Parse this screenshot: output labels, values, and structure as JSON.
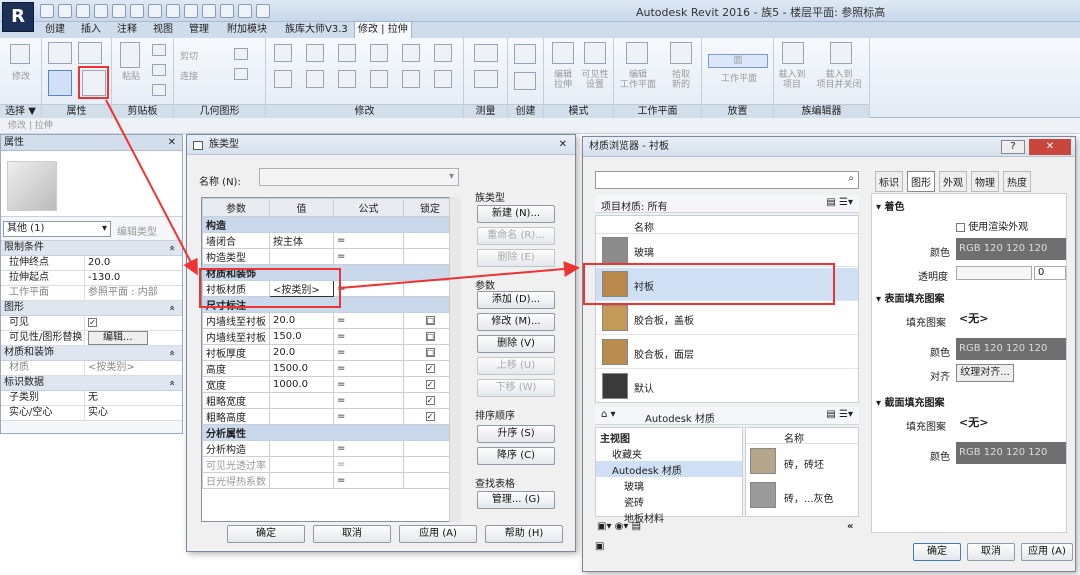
{
  "app": {
    "logo": "R",
    "title": "Autodesk Revit 2016 -     族5 - 楼层平面: 参照标高"
  },
  "tabs": [
    "创建",
    "插入",
    "注释",
    "视图",
    "管理",
    "附加模块",
    "族库大师V3.3",
    "修改 | 拉伸"
  ],
  "ribbon": {
    "panels": [
      "选择",
      "属性",
      "剪贴板",
      "几何图形",
      "修改",
      "测量",
      "创建",
      "模式",
      "工作平面",
      "放置",
      "族编辑器"
    ],
    "buttons": {
      "modify": "修改",
      "select": "选择 ▼",
      "paste": "粘贴",
      "cut": "剪切",
      "join": "连接",
      "edit_extrusion": "编辑\n拉伸",
      "visibility": "可见性\n设置",
      "edit_workplane": "编辑\n工作平面",
      "pick_new": "拾取\n新的",
      "face": "面",
      "workplane": "工作平面",
      "load_project": "载入到\n项目",
      "load_close": "载入到\n项目并关闭"
    }
  },
  "context": "修改 | 拉伸",
  "properties": {
    "title": "属性",
    "close": "✕",
    "type_selector": "其他 (1)",
    "edit_type": "编辑类型",
    "groups": [
      {
        "name": "限制条件",
        "rows": [
          [
            "拉伸终点",
            "20.0"
          ],
          [
            "拉伸起点",
            "-130.0"
          ],
          [
            "工作平面",
            "参照平面 : 内部"
          ]
        ]
      },
      {
        "name": "图形",
        "rows": [
          [
            "可见",
            "✓"
          ],
          [
            "可见性/图形替换",
            "编辑..."
          ]
        ]
      },
      {
        "name": "材质和装饰",
        "rows": [
          [
            "材质",
            "<按类别>"
          ]
        ]
      },
      {
        "name": "标识数据",
        "rows": [
          [
            "子类别",
            "无"
          ],
          [
            "实心/空心",
            "实心"
          ]
        ]
      }
    ]
  },
  "family_types": {
    "title": "族类型",
    "name_label": "名称 (N):",
    "headers": [
      "参数",
      "值",
      "公式",
      "锁定"
    ],
    "groups": [
      {
        "name": "构造",
        "rows": [
          [
            "墙闭合",
            "按主体",
            "=",
            ""
          ],
          [
            "构造类型",
            "",
            "=",
            ""
          ]
        ]
      },
      {
        "name": "材质和装饰",
        "rows": [
          [
            "衬板材质",
            "<按类别>",
            "=",
            ""
          ]
        ]
      },
      {
        "name": "尺寸标注",
        "rows": [
          [
            "内墙线至衬板",
            "20.0",
            "=",
            "□"
          ],
          [
            "内墙线至衬板",
            "150.0",
            "=",
            "□"
          ],
          [
            "衬板厚度",
            "20.0",
            "=",
            "□"
          ],
          [
            "高度",
            "1500.0",
            "=",
            "✓"
          ],
          [
            "宽度",
            "1000.0",
            "=",
            "✓"
          ],
          [
            "粗略宽度",
            "",
            "=",
            "✓"
          ],
          [
            "粗略高度",
            "",
            "=",
            "✓"
          ]
        ]
      },
      {
        "name": "分析属性",
        "rows": [
          [
            "分析构造",
            "",
            "=",
            ""
          ],
          [
            "可见光透过率",
            "",
            "=",
            ""
          ],
          [
            "日光得热系数",
            "",
            "=",
            ""
          ]
        ]
      }
    ],
    "family_types_group": "族类型",
    "new": "新建 (N)...",
    "rename": "重命名 (R)...",
    "delete_type": "删除 (E)",
    "params_group": "参数",
    "add": "添加 (D)...",
    "modify": "修改 (M)...",
    "delete": "删除 (V)",
    "move_up": "上移 (U)",
    "move_down": "下移 (W)",
    "sort_group": "排序顺序",
    "asc": "升序 (S)",
    "desc": "降序 (C)",
    "lookup_group": "查找表格",
    "manage": "管理... (G)",
    "ok": "确定",
    "cancel": "取消",
    "apply": "应用 (A)",
    "help": "帮助 (H)"
  },
  "material_browser": {
    "title": "材质浏览器 - 衬板",
    "help": "?",
    "close": "✕",
    "search_placeholder": "",
    "project_label": "项目材质: 所有",
    "name_header": "名称",
    "materials": [
      {
        "name": "玻璃",
        "color": "#8c8c8c"
      },
      {
        "name": "衬板",
        "color": "#b8894a"
      },
      {
        "name": "胶合板，盖板",
        "color": "#c49a58"
      },
      {
        "name": "胶合板，面层",
        "color": "#b88c4c"
      },
      {
        "name": "默认",
        "color": "#3a3a3a"
      }
    ],
    "library_label": "Autodesk 材质",
    "tree": [
      "主视图",
      "收藏夹",
      "Autodesk 材质",
      "玻璃",
      "瓷砖",
      "地板材料"
    ],
    "lib_name_header": "名称",
    "lib_items": [
      {
        "name": "砖，砖坯",
        "color": "#b5a58a"
      },
      {
        "name": "砖，...灰色",
        "color": "#9a9a9a"
      }
    ],
    "tabs": [
      "标识",
      "图形",
      "外观",
      "物理",
      "热度"
    ],
    "sections": {
      "shading": "着色",
      "use_render": "使用渲染外观",
      "color_label": "颜色",
      "color_value": "RGB 120 120 120",
      "transparency": "透明度",
      "transparency_value": "0",
      "surface_pattern": "表面填充图案",
      "fill_pattern": "填充图案",
      "none": "<无>",
      "surface_color": "RGB 120 120 120",
      "align": "对齐",
      "align_btn": "纹理对齐...",
      "cut_pattern": "截面填充图案",
      "cut_color": "RGB 120 120 120"
    },
    "ok": "确定",
    "cancel": "取消",
    "apply": "应用 (A)"
  }
}
